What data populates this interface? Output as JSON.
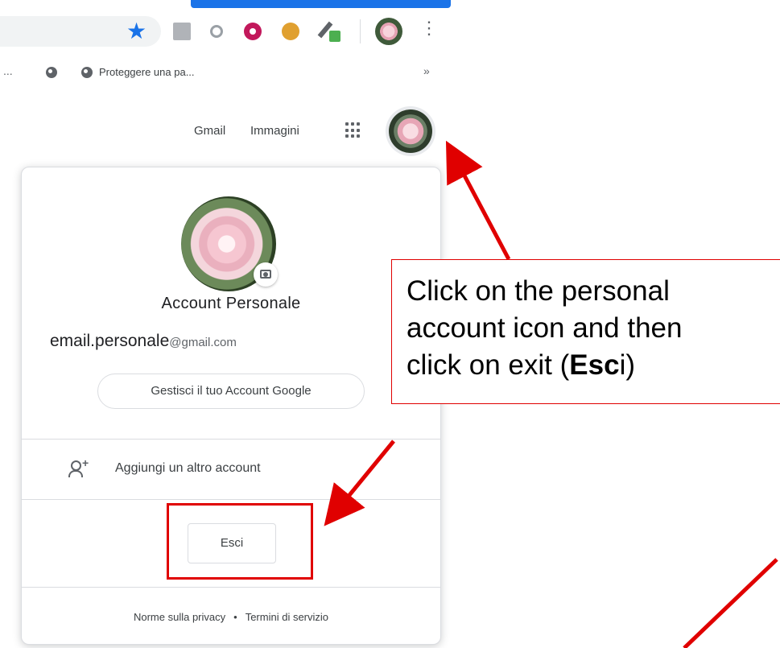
{
  "browser": {
    "bookmarks": {
      "overflow_left": "...",
      "item_label": "Proteggere una pa...",
      "overflow_right": "»"
    },
    "icons": [
      "star-icon",
      "pdf-extension-icon",
      "ring-extension-icon",
      "donut-extension-icon",
      "cookie-extension-icon",
      "eyedropper-extension-icon",
      "profile-avatar",
      "menu-kebab-icon"
    ],
    "accent_color": "#1a73e8"
  },
  "header": {
    "gmail_label": "Gmail",
    "images_label": "Immagini"
  },
  "account_card": {
    "name": "Account Personale",
    "email_user": "email.personale",
    "email_domain": "@gmail.com",
    "manage_label": "Gestisci il tuo Account Google",
    "add_account_label": "Aggiungi un altro account",
    "sign_out_label": "Esci",
    "privacy_label": "Norme sulla privacy",
    "separator": "•",
    "terms_label": "Termini di servizio"
  },
  "annotation": {
    "line1": "Click on the personal",
    "line2": "account icon and then",
    "line3_prefix": "click on exit (",
    "line3_bold": "Esc",
    "line3_suffix": "i)",
    "color": "#e00000"
  }
}
